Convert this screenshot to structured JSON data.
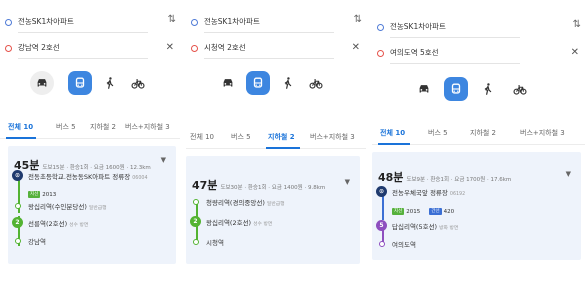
{
  "colors": {
    "accent": "#3d86e0",
    "tab_active": "#1a73d9",
    "subway_line_2": "#53b332",
    "subway_line_5": "#8e4fbf",
    "bus_green": "#56b13c",
    "bus_blue": "#3b6fd4",
    "bus_stop_icon": "#1f3a6e"
  },
  "panels": [
    {
      "from": "전농SK1차아파트",
      "to": "강남역 2호선",
      "active_tab_index": 0,
      "tabs": [
        {
          "label": "전체 10"
        },
        {
          "label": "버스 5"
        },
        {
          "label": "지하철 2"
        },
        {
          "label": "버스+지하철 3"
        }
      ],
      "route": {
        "duration": "45분",
        "meta": "도보15분 · 환승1회 · 요금 1600원 · 12.3km",
        "stops": [
          {
            "icon": "bus-stop",
            "name": "전동초등학교.전농동SK아파트 정류장",
            "sub": "06004"
          },
          {
            "bus_chips": [
              {
                "label": "지선",
                "color": "green",
                "number": "2013"
              }
            ]
          },
          {
            "icon": "ring",
            "name": "왕십리역(수인분당선)",
            "sub": "일반급행"
          },
          {
            "icon": "line-2",
            "badge": "2",
            "name": "선릉역(2호선)",
            "sub": "성수 방면"
          },
          {
            "icon": "ring",
            "name": "강남역"
          }
        ]
      }
    },
    {
      "from": "전농SK1차아파트",
      "to": "시청역 2호선",
      "active_tab_index": 2,
      "tabs": [
        {
          "label": "전체 10"
        },
        {
          "label": "버스 5"
        },
        {
          "label": "지하철 2"
        },
        {
          "label": "버스+지하철 3"
        }
      ],
      "route": {
        "duration": "47분",
        "meta": "도보30분 · 환승1회 · 요금 1400원 · 9.8km",
        "stops": [
          {
            "icon": "ring",
            "name": "청량리역(경의중앙선)",
            "sub": "일반급행"
          },
          {
            "icon": "line-2",
            "badge": "2",
            "name": "왕십리역(2호선)",
            "sub": "성수 방면"
          },
          {
            "icon": "ring",
            "name": "시청역"
          }
        ]
      }
    },
    {
      "from": "전농SK1차아파트",
      "to": "여의도역 5호선",
      "active_tab_index": 0,
      "tabs": [
        {
          "label": "전체 10"
        },
        {
          "label": "버스 5"
        },
        {
          "label": "지하철 2"
        },
        {
          "label": "버스+지하철 3"
        }
      ],
      "route": {
        "duration": "48분",
        "meta": "도보9분 · 환승1회 · 요금 1700원 · 17.6km",
        "stops": [
          {
            "icon": "bus-stop",
            "name": "전농우체국앞 정류장",
            "sub": "06192"
          },
          {
            "bus_chips": [
              {
                "label": "지선",
                "color": "green",
                "number": "2015"
              },
              {
                "label": "간선",
                "color": "blue",
                "number": "420"
              }
            ]
          },
          {
            "icon": "line-5",
            "badge": "5",
            "name": "답십리역(5호선)",
            "sub": "방화 방면"
          },
          {
            "icon": "ring-purple",
            "name": "여의도역"
          }
        ]
      }
    }
  ],
  "modes": [
    "car-icon",
    "bus-icon",
    "walk-icon",
    "bike-icon"
  ]
}
